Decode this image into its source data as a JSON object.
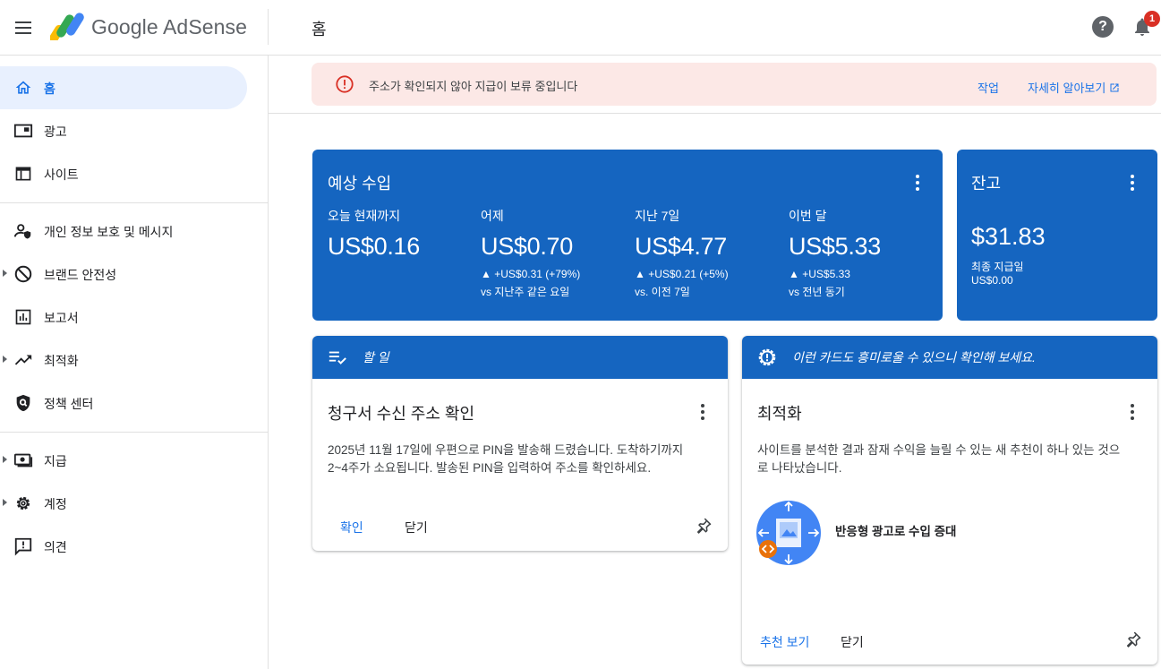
{
  "header": {
    "brand": "Google AdSense",
    "page_title": "홈",
    "help_label": "?",
    "notification_count": "1"
  },
  "sidebar": {
    "items": [
      {
        "label": "홈",
        "icon": "home-icon"
      },
      {
        "label": "광고",
        "icon": "ads-icon"
      },
      {
        "label": "사이트",
        "icon": "sites-icon"
      },
      {
        "label": "개인 정보 보호 및 메시지",
        "icon": "privacy-icon"
      },
      {
        "label": "브랜드 안전성",
        "icon": "block-icon"
      },
      {
        "label": "보고서",
        "icon": "report-icon"
      },
      {
        "label": "최적화",
        "icon": "trending-icon"
      },
      {
        "label": "정책 센터",
        "icon": "policy-icon"
      },
      {
        "label": "지급",
        "icon": "payments-icon"
      },
      {
        "label": "계정",
        "icon": "gear-icon"
      },
      {
        "label": "의견",
        "icon": "feedback-icon"
      }
    ]
  },
  "banner": {
    "message": "주소가 확인되지 않아 지급이 보류 중입니다",
    "action_label": "작업",
    "learn_more_label": "자세히 알아보기"
  },
  "earnings": {
    "title": "예상 수입",
    "metrics": [
      {
        "label": "오늘 현재까지",
        "value": "US$0.16",
        "change": "",
        "compare": ""
      },
      {
        "label": "어제",
        "value": "US$0.70",
        "change": "▲ +US$0.31 (+79%)",
        "compare": "vs 지난주 같은 요일"
      },
      {
        "label": "지난 7일",
        "value": "US$4.77",
        "change": "▲ +US$0.21 (+5%)",
        "compare": "vs. 이전 7일"
      },
      {
        "label": "이번 달",
        "value": "US$5.33",
        "change": "▲ +US$5.33",
        "compare": "vs 전년 동기"
      }
    ]
  },
  "balance": {
    "title": "잔고",
    "value": "$31.83",
    "last_payment_label": "최종 지급일",
    "last_payment_value": "US$0.00"
  },
  "todo_card": {
    "header": "할 일",
    "title": "청구서 수신 주소 확인",
    "body_line1": "2025년 11월 17일에 우편으로 PIN을 발송해 드렸습니다. 도착하기까지",
    "body_line2": "2~4주가 소요됩니다. 발송된 PIN을 입력하여 주소를 확인하세요.",
    "confirm_label": "확인",
    "close_label": "닫기"
  },
  "tip_card": {
    "header": "이런 카드도 흥미로울 수 있으니 확인해 보세요.",
    "title": "최적화",
    "body_line1": "사이트를 분석한 결과 잠재 수익을 늘릴 수 있는 새 추천이 하나 있는 것으",
    "body_line2": "로 나타났습니다.",
    "recommendation": "반응형 광고로 수입 증대",
    "view_label": "추천 보기",
    "close_label": "닫기"
  },
  "colors": {
    "primary_blue": "#1565c0",
    "link_blue": "#1a73e8",
    "error_red": "#d93025",
    "banner_bg": "#fce8e6",
    "active_nav_bg": "#e8f0fe"
  }
}
